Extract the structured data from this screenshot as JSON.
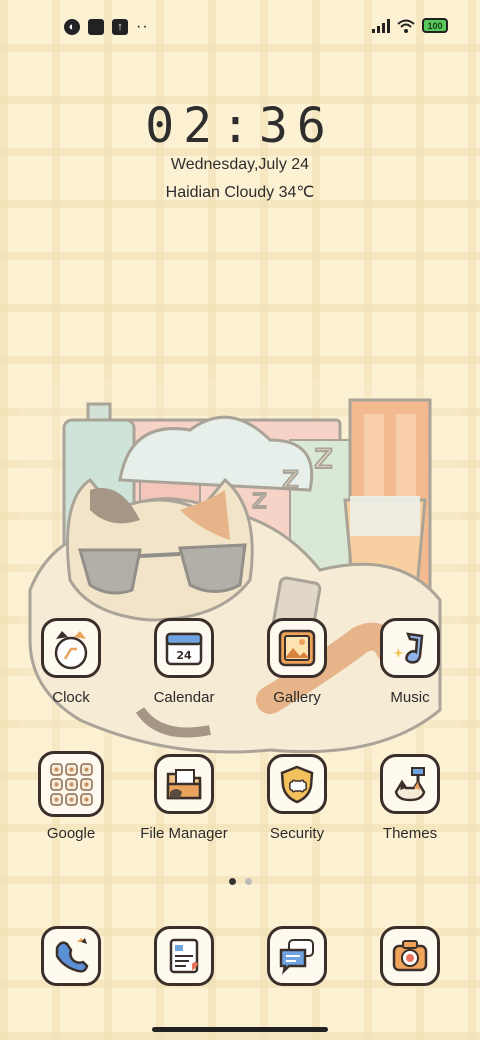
{
  "status_bar": {
    "left_icons": [
      "app-notification-icon",
      "square-notification-icon",
      "upload-notification-icon"
    ],
    "more_indicator": "··",
    "battery_level": "100"
  },
  "lock_clock": {
    "time": "02:36",
    "date": "Wednesday,July 24",
    "weather": "Haidian Cloudy 34℃"
  },
  "apps_row1": [
    {
      "label": "Clock",
      "icon": "clock-icon"
    },
    {
      "label": "Calendar",
      "icon": "calendar-icon"
    },
    {
      "label": "Gallery",
      "icon": "gallery-icon"
    },
    {
      "label": "Music",
      "icon": "music-icon"
    }
  ],
  "apps_row2": [
    {
      "label": "Google",
      "icon": "google-folder-icon"
    },
    {
      "label": "File Manager",
      "icon": "file-manager-icon"
    },
    {
      "label": "Security",
      "icon": "security-icon"
    },
    {
      "label": "Themes",
      "icon": "themes-icon"
    }
  ],
  "dock": [
    {
      "icon": "phone-icon"
    },
    {
      "icon": "notes-icon"
    },
    {
      "icon": "messages-icon"
    },
    {
      "icon": "camera-icon"
    }
  ],
  "page_indicator": {
    "pages": 2,
    "current": 1
  }
}
